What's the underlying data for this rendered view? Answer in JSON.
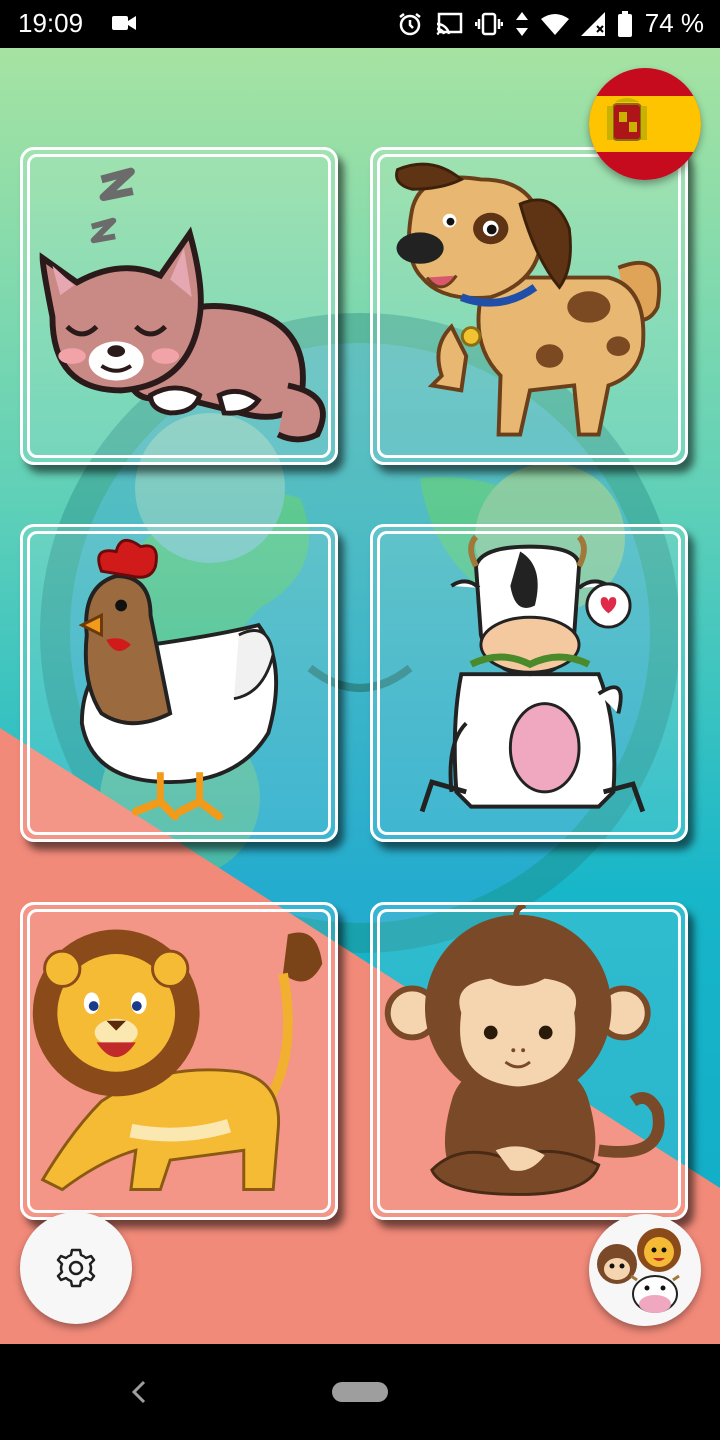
{
  "status_bar": {
    "time": "19:09",
    "battery_percent": "74 %",
    "icons": [
      "video-camera-icon",
      "alarm-icon",
      "cast-icon",
      "vibrate-icon",
      "data-arrows-icon",
      "wifi-icon",
      "signal-icon",
      "battery-icon"
    ]
  },
  "header": {
    "language_flag": "spain-flag-icon"
  },
  "animal_cards": [
    {
      "animal": "cat",
      "icon": "sleeping-cat-icon"
    },
    {
      "animal": "dog",
      "icon": "dog-icon"
    },
    {
      "animal": "hen",
      "icon": "hen-icon"
    },
    {
      "animal": "cow",
      "icon": "cow-icon"
    },
    {
      "animal": "lion",
      "icon": "lion-icon"
    },
    {
      "animal": "monkey",
      "icon": "monkey-icon"
    }
  ],
  "footer": {
    "settings_icon": "gear-icon",
    "animals_menu_icon": "animals-group-icon"
  },
  "colors": {
    "background_top": "#9fe0a8",
    "background_mid": "#2fbfc6",
    "background_coral": "#f08677",
    "card_border": "#ffffff",
    "flag_red": "#c60b1e",
    "flag_yellow": "#ffc400"
  }
}
